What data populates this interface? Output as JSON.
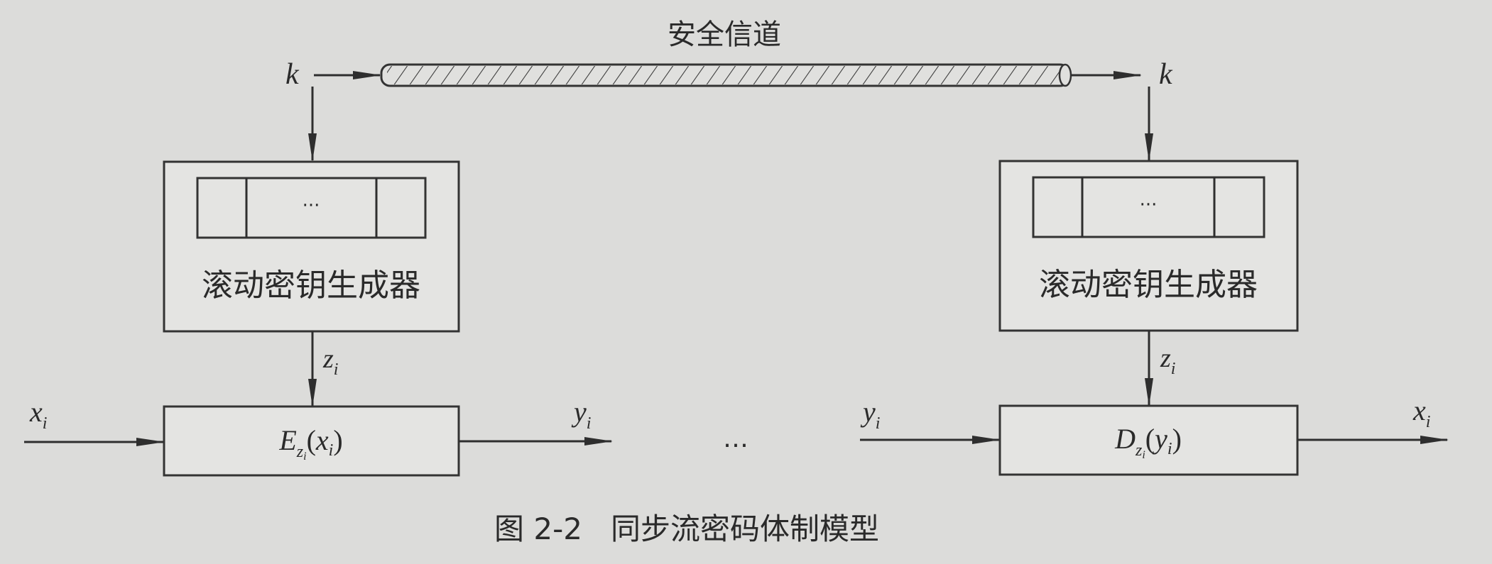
{
  "diagram": {
    "channel_label": "安全信道",
    "key_symbol": "k",
    "generator_label": "滚动密钥生成器",
    "register_ellipsis": "···",
    "keystream": {
      "base": "z",
      "sub": "i"
    },
    "plaintext": {
      "base": "x",
      "sub": "i"
    },
    "ciphertext": {
      "base": "y",
      "sub": "i"
    },
    "encrypt_block": {
      "func": "E",
      "sub_base": "z",
      "sub_sub": "i",
      "arg_base": "x",
      "arg_sub": "i"
    },
    "decrypt_block": {
      "func": "D",
      "sub_base": "z",
      "sub_sub": "i",
      "arg_base": "y",
      "arg_sub": "i"
    },
    "middle_ellipsis": "…",
    "caption": "图 2-2   同步流密码体制模型"
  },
  "colors": {
    "background": "#dcdcda",
    "line": "#2e2e2e"
  }
}
